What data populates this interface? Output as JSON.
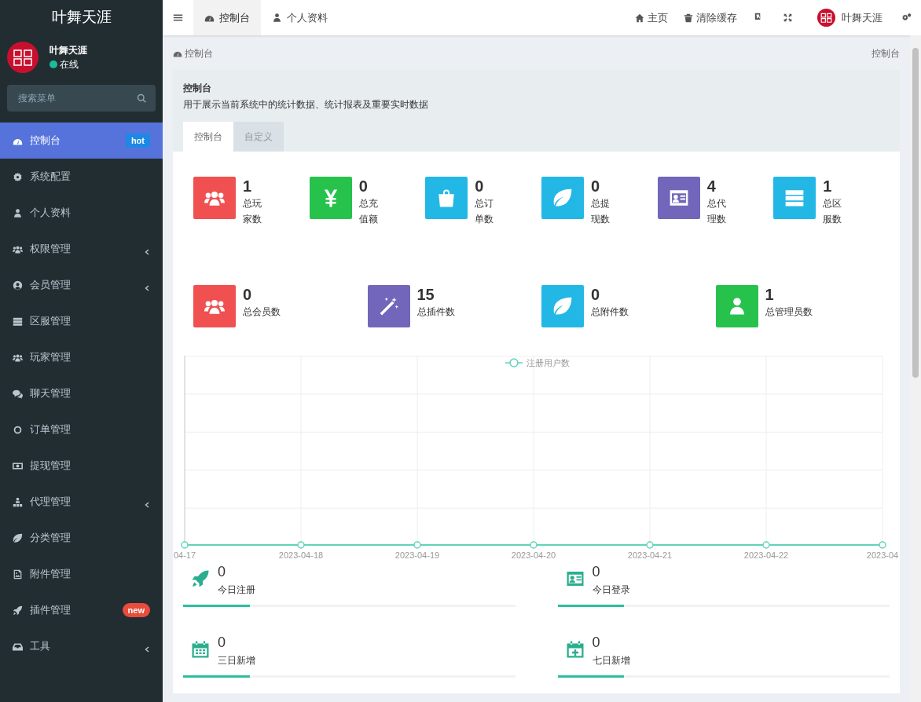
{
  "sidebar": {
    "logo": "叶舞天涯",
    "user": {
      "name": "叶舞天涯",
      "status": "在线",
      "online": true
    },
    "search": {
      "placeholder": "搜索菜单"
    },
    "items": [
      {
        "label": "控制台",
        "selected": true,
        "badge": {
          "text": "hot",
          "color": "#1e88e5"
        }
      },
      {
        "label": "系统配置",
        "selected": false
      },
      {
        "label": "个人资料",
        "selected": false
      },
      {
        "label": "权限管理",
        "selected": false,
        "expandable": true
      },
      {
        "label": "会员管理",
        "selected": false,
        "expandable": true
      },
      {
        "label": "区服管理",
        "selected": false
      },
      {
        "label": "玩家管理",
        "selected": false
      },
      {
        "label": "聊天管理",
        "selected": false
      },
      {
        "label": "订单管理",
        "selected": false
      },
      {
        "label": "提现管理",
        "selected": false
      },
      {
        "label": "代理管理",
        "selected": false,
        "expandable": true
      },
      {
        "label": "分类管理",
        "selected": false
      },
      {
        "label": "附件管理",
        "selected": false
      },
      {
        "label": "插件管理",
        "selected": false,
        "badge": {
          "text": "new",
          "color": "#e74c3c"
        }
      },
      {
        "label": "工具",
        "selected": false,
        "expandable": true
      }
    ]
  },
  "header": {
    "tabs": [
      {
        "label": "控制台",
        "selected": true
      },
      {
        "label": "个人资料",
        "selected": false
      }
    ],
    "links": [
      "主页",
      "清除缓存"
    ],
    "user": "叶舞天涯"
  },
  "breadcrumb": {
    "left": "控制台",
    "right": "控制台"
  },
  "panel": {
    "title": "控制台",
    "description": "用于展示当前系统中的统计数据、统计报表及重要实时数据",
    "tabs": [
      {
        "label": "控制台",
        "selected": true
      },
      {
        "label": "自定义",
        "selected": false
      }
    ]
  },
  "stats_row_1": [
    {
      "value": "1",
      "label": "总玩家数",
      "color": "#f05050"
    },
    {
      "value": "0",
      "label": "总充值额",
      "color": "#27c24c"
    },
    {
      "value": "0",
      "label": "总订单数",
      "color": "#23b7e5"
    },
    {
      "value": "0",
      "label": "总提现数",
      "color": "#23b7e5"
    },
    {
      "value": "4",
      "label": "总代理数",
      "color": "#7266ba"
    },
    {
      "value": "1",
      "label": "总区服数",
      "color": "#23b7e5"
    }
  ],
  "stats_row_2": [
    {
      "value": "0",
      "label": "总会员数",
      "color": "#f05050"
    },
    {
      "value": "15",
      "label": "总插件数",
      "color": "#7266ba"
    },
    {
      "value": "0",
      "label": "总附件数",
      "color": "#23b7e5"
    },
    {
      "value": "1",
      "label": "总管理员数",
      "color": "#27c24c"
    }
  ],
  "chart": {
    "legend": "注册用户数",
    "x_labels": [
      "04-17",
      "2023-04-18",
      "2023-04-19",
      "2023-04-20",
      "2023-04-21",
      "2023-04-22",
      "2023-04"
    ]
  },
  "summary": [
    {
      "value": "0",
      "label": "今日注册",
      "level": 0.2
    },
    {
      "value": "0",
      "label": "今日登录",
      "level": 0.2
    },
    {
      "value": "0",
      "label": "三日新增",
      "level": 0.2
    },
    {
      "value": "0",
      "label": "七日新增",
      "level": 0.2
    }
  ]
}
